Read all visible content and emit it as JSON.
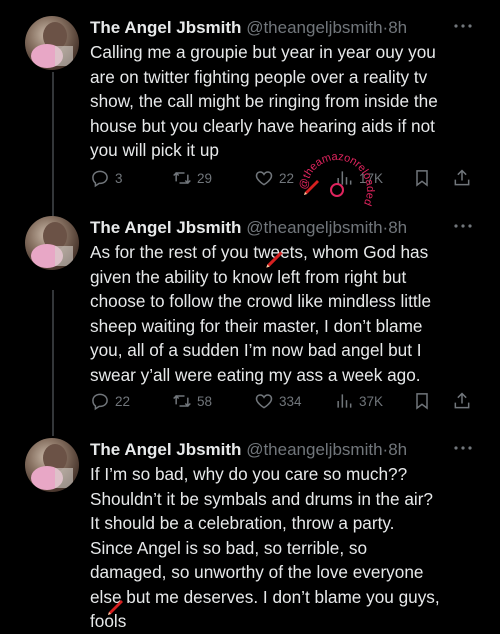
{
  "tweets": [
    {
      "name": "The Angel Jbsmith",
      "handle": "@theangeljbsmith",
      "separator": "·",
      "time": "8h",
      "text": "Calling me a groupie but year in year ouy you\nare on twitter fighting people over a reality tv\nshow, the call might be ringing from inside the\nhouse but you clearly have hearing aids if not\nyou will pick it up",
      "replies": "3",
      "reposts": "29",
      "likes": "22",
      "views": "17K"
    },
    {
      "name": "The Angel Jbsmith",
      "handle": "@theangeljbsmith",
      "separator": "·",
      "time": "8h",
      "text": "As for the rest of you tweets, whom God has\ngiven the ability to know left from right but\nchoose to follow the crowd like mindless little\nsheep waiting for their master, I don’t blame\nyou, all of a sudden I’m now bad angel but I\nswear y’all were eating my ass a week ago.",
      "replies": "22",
      "reposts": "58",
      "likes": "334",
      "views": "37K"
    },
    {
      "name": "The Angel Jbsmith",
      "handle": "@theangeljbsmith",
      "separator": "·",
      "time": "8h",
      "text": "If I’m so bad, why do you care so much??\nShouldn’t it be symbals and drums in the air?\nIt should be a celebration, throw a party.\nSince Angel is so bad, so terrible, so\ndamaged, so unworthy of the love everyone\nelse but me deserves. I don’t blame you guys,\nfools"
    }
  ],
  "icons": {
    "more": "more-icon",
    "reply": "reply-icon",
    "repost": "repost-icon",
    "like": "heart-icon",
    "views": "views-icon",
    "bookmark": "bookmark-icon",
    "share": "share-icon"
  },
  "watermark": {
    "text": "@theamazonreloaded",
    "color": "#e0245e"
  },
  "colors": {
    "background": "#000000",
    "primary_text": "#e7e9ea",
    "secondary_text": "#71767b",
    "thread_line": "#333639",
    "pencil_red": "#d62020"
  }
}
